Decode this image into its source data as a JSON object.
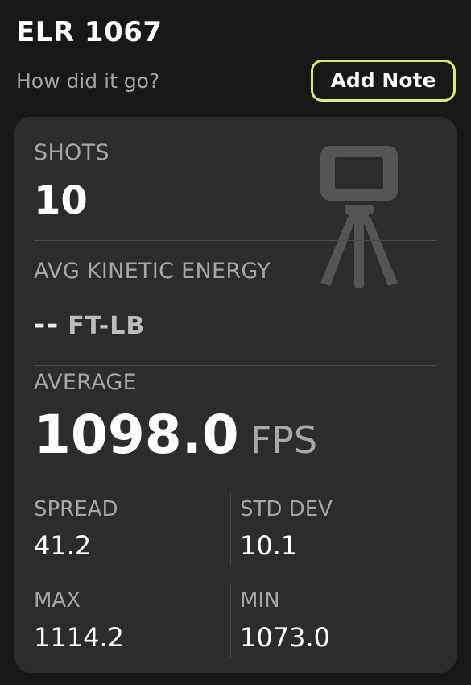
{
  "header": {
    "title": "ELR 1067",
    "subtitle": "How did it go?",
    "add_note_label": "Add Note",
    "accent_color": "#d6ea7a"
  },
  "card": {
    "shots": {
      "label": "SHOTS",
      "value": "10"
    },
    "kinetic_energy": {
      "label": "AVG KINETIC ENERGY",
      "value": "--",
      "unit": "FT-LB"
    },
    "average": {
      "label": "AVERAGE",
      "value": "1098.0",
      "unit": "FPS"
    },
    "spread": {
      "label": "SPREAD",
      "value": "41.2"
    },
    "std_dev": {
      "label": "STD DEV",
      "value": "10.1"
    },
    "max": {
      "label": "MAX",
      "value": "1114.2"
    },
    "min": {
      "label": "MIN",
      "value": "1073.0"
    },
    "background_icon": "chronograph-tripod-icon"
  }
}
